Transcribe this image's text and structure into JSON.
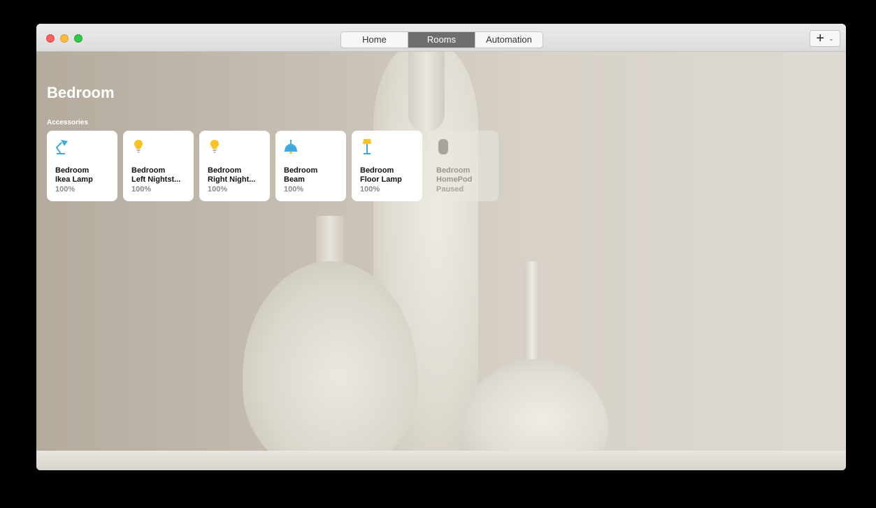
{
  "tabs": [
    {
      "label": "Home",
      "active": false
    },
    {
      "label": "Rooms",
      "active": true
    },
    {
      "label": "Automation",
      "active": false
    }
  ],
  "toolbar": {
    "add_label": "+",
    "menu_chevron": "⌄"
  },
  "room": {
    "title": "Bedroom",
    "section_label": "Accessories"
  },
  "accessories": [
    {
      "name": "Bedroom\nIkea Lamp",
      "status": "100%",
      "icon": "desk-lamp-icon",
      "active": true
    },
    {
      "name": "Bedroom\nLeft Nightst...",
      "status": "100%",
      "icon": "lightbulb-icon",
      "active": true
    },
    {
      "name": "Bedroom\nRight Night...",
      "status": "100%",
      "icon": "lightbulb-icon",
      "active": true
    },
    {
      "name": "Bedroom\nBeam",
      "status": "100%",
      "icon": "pendant-lamp-icon",
      "active": true
    },
    {
      "name": "Bedroom\nFloor Lamp",
      "status": "100%",
      "icon": "floor-lamp-icon",
      "active": true
    },
    {
      "name": "Bedroom\nHomePod",
      "status": "Paused",
      "icon": "homepod-icon",
      "active": false
    }
  ],
  "colors": {
    "bulb": "#f7c325",
    "lamp_blue": "#3ea9de",
    "homepod": "#a8a49c"
  }
}
